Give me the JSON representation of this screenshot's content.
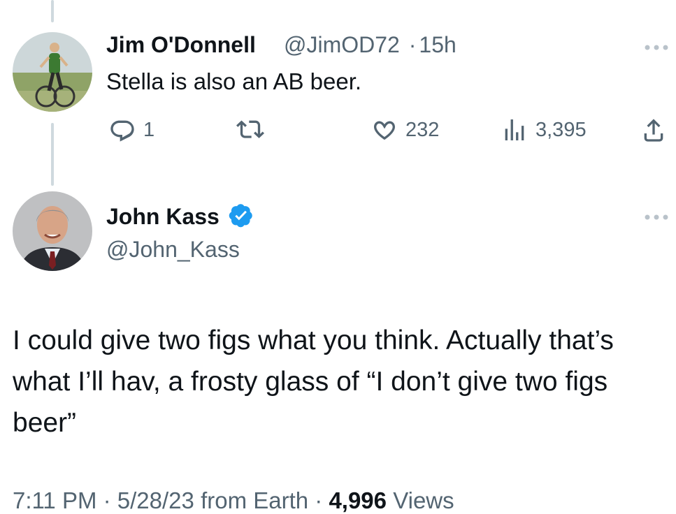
{
  "reply_tweet": {
    "author_name": "Jim O'Donnell",
    "handle": "@JimOD72",
    "separator": "·",
    "time_ago": "15h",
    "text": "Stella is also an AB beer.",
    "actions": {
      "reply_count": "1",
      "retweet_count": "",
      "like_count": "232",
      "view_count": "3,395"
    },
    "icons": [
      "reply-icon",
      "retweet-icon",
      "like-icon",
      "views-icon",
      "share-icon",
      "more-icon"
    ]
  },
  "main_tweet": {
    "author_name": "John Kass",
    "verified": true,
    "handle": "@John_Kass",
    "text": "I could give two figs what you think. Actually that’s what I’ll hav, a frosty glass of “I don’t give two figs beer”",
    "meta": {
      "time": "7:11 PM",
      "date": "5/28/23",
      "source": "from Earth",
      "views_count": "4,996",
      "views_label": "Views"
    }
  },
  "colors": {
    "text": "#0f1419",
    "secondary": "#536471",
    "verified": "#1d9bf0",
    "thread_line": "#cfd9de"
  }
}
